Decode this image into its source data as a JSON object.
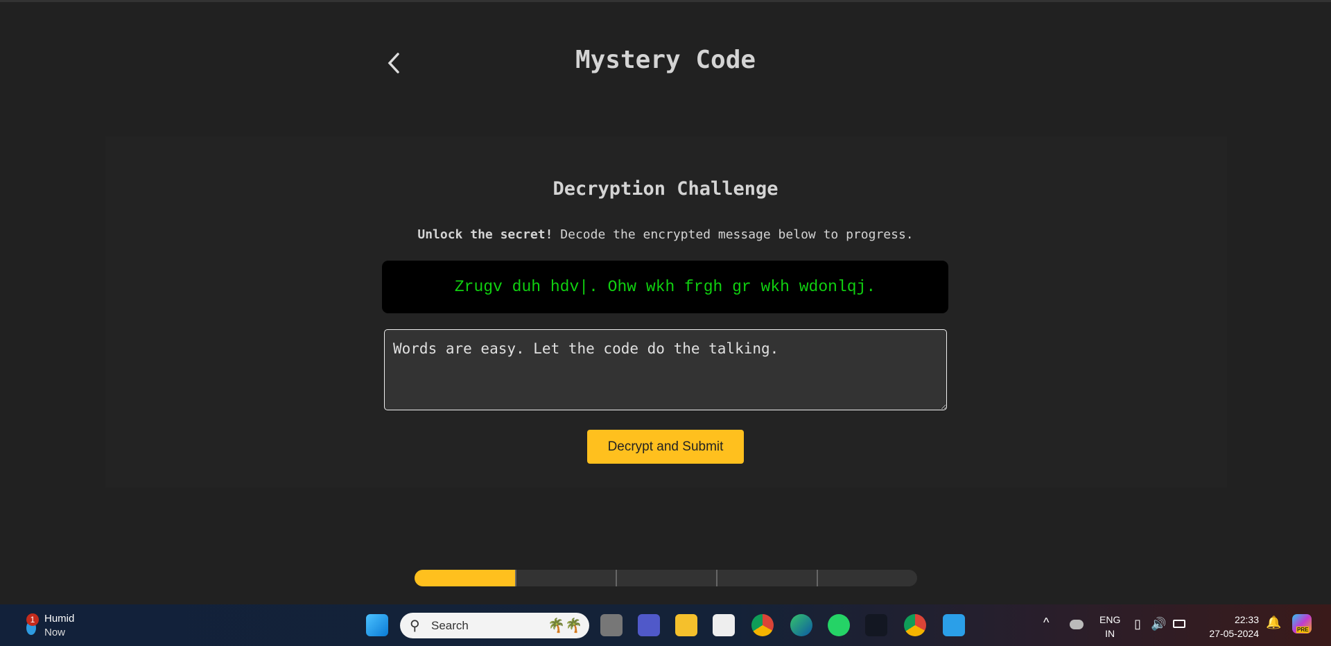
{
  "header": {
    "title": "Mystery Code"
  },
  "challenge": {
    "heading": "Decryption Challenge",
    "intro_bold": "Unlock the secret!",
    "intro_rest": " Decode the encrypted message below to progress.",
    "cipher_text": "Zrugv duh hdv|. Ohw wkh frgh gr wkh wdonlqj.",
    "answer_value": "Words are easy. Let the code do the talking.",
    "submit_label": "Decrypt and Submit"
  },
  "progress": {
    "segments": 5,
    "completed": 1,
    "percent": 20,
    "color": "#ffc01e"
  },
  "taskbar": {
    "weather_title": "Humid",
    "weather_sub": "Now",
    "weather_badge": "1",
    "search_placeholder": "Search",
    "lang_1": "ENG",
    "lang_2": "IN",
    "time": "22:33",
    "date": "27-05-2024",
    "copilot_badge": "PRE"
  }
}
